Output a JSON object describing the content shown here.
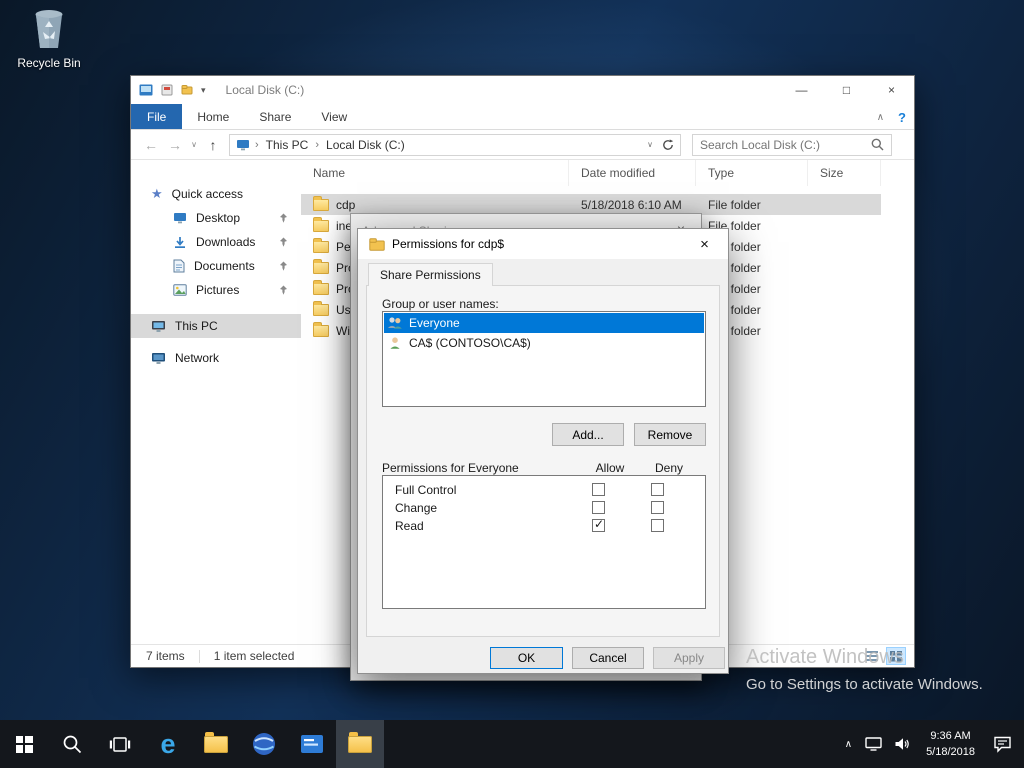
{
  "icons": {
    "minimize": "—",
    "maximize": "□",
    "close": "×",
    "back": "←",
    "forward": "→",
    "up": "↑",
    "history_chevron": "∨",
    "address_chevron": "∨",
    "ribbon_collapse": "∧",
    "help": "?",
    "crumb_sep": "›",
    "qat_chevron": "▾",
    "edge_logo": "e",
    "tray_chevron": "∧",
    "quick_access_star": "★"
  },
  "desktop": {
    "recycle_bin_label": "Recycle Bin",
    "watermark_line1": "Activate Windows",
    "watermark_line2": "Go to Settings to activate Windows."
  },
  "explorer": {
    "title": "Local Disk (C:)",
    "ribbon_tabs": [
      "File",
      "Home",
      "Share",
      "View"
    ],
    "breadcrumb": [
      "This PC",
      "Local Disk (C:)"
    ],
    "search_placeholder": "Search Local Disk (C:)",
    "sidebar": {
      "quick_access_label": "Quick access",
      "quick_access_items": [
        "Desktop",
        "Downloads",
        "Documents",
        "Pictures"
      ],
      "this_pc_label": "This PC",
      "this_pc_selected": true,
      "network_label": "Network"
    },
    "columns": [
      "Name",
      "Date modified",
      "Type",
      "Size"
    ],
    "files": [
      {
        "name": "cdp",
        "date_modified": "5/18/2018 6:10 AM",
        "type": "File folder",
        "size": "",
        "selected": true
      },
      {
        "name": "inetpub",
        "date_modified": "",
        "type": "File folder",
        "size": "",
        "selected": false
      },
      {
        "name": "PerfLogs",
        "date_modified": "",
        "type": "File folder",
        "size": "",
        "selected": false
      },
      {
        "name": "Program Files",
        "date_modified": "",
        "type": "File folder",
        "size": "",
        "selected": false
      },
      {
        "name": "Program Files (x86)",
        "date_modified": "",
        "type": "File folder",
        "size": "",
        "selected": false
      },
      {
        "name": "Users",
        "date_modified": "",
        "type": "File folder",
        "size": "",
        "selected": false
      },
      {
        "name": "Windows",
        "date_modified": "",
        "type": "File folder",
        "size": "",
        "selected": false
      }
    ],
    "status_items": "7 items",
    "status_selected": "1 item selected"
  },
  "advanced_sharing_dialog": {
    "title": "Advanced Sharing"
  },
  "permissions_dialog": {
    "title": "Permissions for cdp$",
    "tab_label": "Share Permissions",
    "group_label": "Group or user names:",
    "groups": [
      {
        "name": "Everyone",
        "selected": true
      },
      {
        "name": "CA$ (CONTOSO\\CA$)",
        "selected": false
      }
    ],
    "add_label": "Add...",
    "remove_label": "Remove",
    "permissions_label": "Permissions for Everyone",
    "allow_header": "Allow",
    "deny_header": "Deny",
    "permissions": [
      {
        "name": "Full Control",
        "allow": false,
        "deny": false
      },
      {
        "name": "Change",
        "allow": false,
        "deny": false
      },
      {
        "name": "Read",
        "allow": true,
        "deny": false
      }
    ],
    "ok_label": "OK",
    "cancel_label": "Cancel",
    "apply_label": "Apply",
    "apply_disabled": true
  },
  "taskbar": {
    "time": "9:36 AM",
    "date": "5/18/2018"
  }
}
